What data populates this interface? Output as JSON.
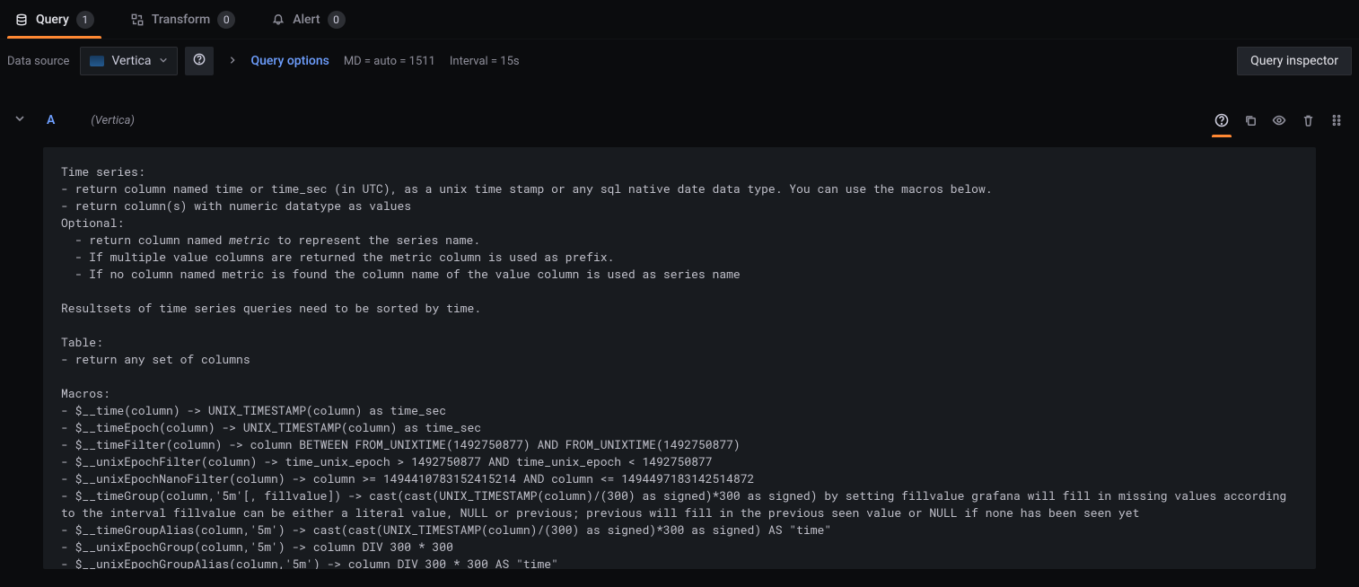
{
  "tabs": {
    "query": {
      "label": "Query",
      "count": "1"
    },
    "transform": {
      "label": "Transform",
      "count": "0"
    },
    "alert": {
      "label": "Alert",
      "count": "0"
    }
  },
  "toolbar": {
    "ds_label": "Data source",
    "ds_name": "Vertica",
    "query_options_label": "Query options",
    "md_text": "MD = auto = 1511",
    "interval_text": "Interval = 15s",
    "inspector_label": "Query inspector"
  },
  "query": {
    "name": "A",
    "ds": "(Vertica)"
  },
  "help": {
    "l1": "Time series:",
    "l2": "- return column named time or time_sec (in UTC), as a unix time stamp or any sql native date data type. You can use the macros below.",
    "l3": "- return column(s) with numeric datatype as values",
    "l4": "Optional:",
    "l5a": "  - return column named ",
    "l5b": "metric",
    "l5c": " to represent the series name.",
    "l6": "  - If multiple value columns are returned the metric column is used as prefix.",
    "l7": "  - If no column named metric is found the column name of the value column is used as series name",
    "l8": "Resultsets of time series queries need to be sorted by time.",
    "l9": "Table:",
    "l10": "- return any set of columns",
    "l11": "Macros:",
    "l12": "- $__time(column) -> UNIX_TIMESTAMP(column) as time_sec",
    "l13": "- $__timeEpoch(column) -> UNIX_TIMESTAMP(column) as time_sec",
    "l14": "- $__timeFilter(column) -> column BETWEEN FROM_UNIXTIME(1492750877) AND FROM_UNIXTIME(1492750877)",
    "l15": "- $__unixEpochFilter(column) -> time_unix_epoch > 1492750877 AND time_unix_epoch < 1492750877",
    "l16": "- $__unixEpochNanoFilter(column) -> column >= 1494410783152415214 AND column <= 1494497183142514872",
    "l17": "- $__timeGroup(column,'5m'[, fillvalue]) -> cast(cast(UNIX_TIMESTAMP(column)/(300) as signed)*300 as signed) by setting fillvalue grafana will fill in missing values according to the interval fillvalue can be either a literal value, NULL or previous; previous will fill in the previous seen value or NULL if none has been seen yet",
    "l18": "- $__timeGroupAlias(column,'5m') -> cast(cast(UNIX_TIMESTAMP(column)/(300) as signed)*300 as signed) AS \"time\"",
    "l19": "- $__unixEpochGroup(column,'5m') -> column DIV 300 * 300",
    "l20": "- $__unixEpochGroupAlias(column,'5m') -> column DIV 300 * 300 AS \"time\""
  }
}
